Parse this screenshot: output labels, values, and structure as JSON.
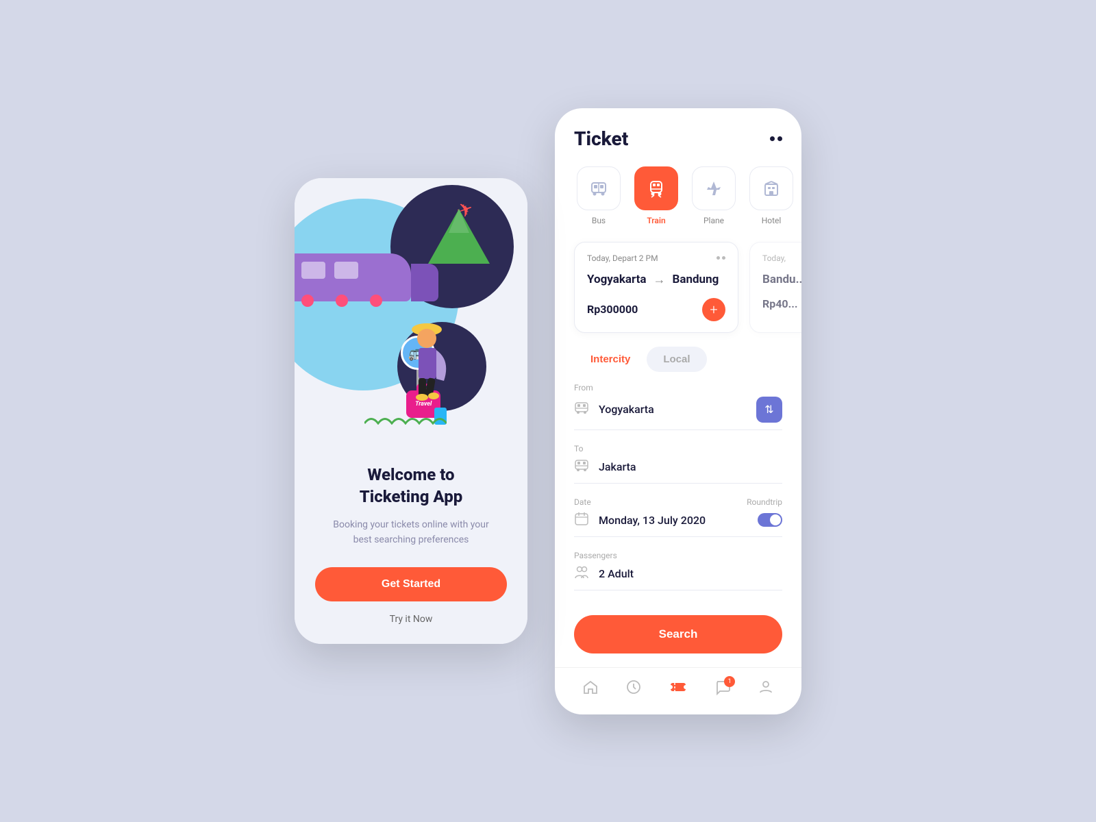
{
  "leftPhone": {
    "welcomeTitle": "Welcome to\nTicketing App",
    "subtitle": "Booking your tickets online with your best searching preferences",
    "getStartedLabel": "Get Started",
    "tryNowLabel": "Try it Now"
  },
  "rightPhone": {
    "headerTitle": "Ticket",
    "categories": [
      {
        "id": "bus",
        "label": "Bus",
        "icon": "🚌",
        "active": false
      },
      {
        "id": "train",
        "label": "Train",
        "icon": "🚆",
        "active": true
      },
      {
        "id": "plane",
        "label": "Plane",
        "icon": "✈️",
        "active": false
      },
      {
        "id": "hotel",
        "label": "Hotel",
        "icon": "🏨",
        "active": false
      }
    ],
    "tickets": [
      {
        "dateInfo": "Today, Depart 2 PM",
        "from": "Yogyakarta",
        "to": "Bandung",
        "price": "Rp300000"
      },
      {
        "dateInfo": "Today,",
        "from": "Bandu",
        "to": "...",
        "price": "Rp40..."
      }
    ],
    "tabs": [
      {
        "label": "Intercity",
        "active": true
      },
      {
        "label": "Local",
        "active": false
      }
    ],
    "form": {
      "fromLabel": "From",
      "fromValue": "Yogyakarta",
      "toLabel": "To",
      "toValue": "Jakarta",
      "dateLabel": "Date",
      "dateValue": "Monday, 13 July 2020",
      "roundtripLabel": "Roundtrip",
      "passengersLabel": "Passengers",
      "passengersValue": "2 Adult"
    },
    "searchLabel": "Search",
    "bottomNav": [
      {
        "icon": "🏠",
        "active": false,
        "name": "home"
      },
      {
        "icon": "🕐",
        "active": false,
        "name": "history"
      },
      {
        "icon": "🎫",
        "active": true,
        "name": "tickets",
        "badge": null
      },
      {
        "icon": "💬",
        "active": false,
        "name": "chat",
        "badge": "1"
      },
      {
        "icon": "👤",
        "active": false,
        "name": "profile"
      }
    ]
  }
}
